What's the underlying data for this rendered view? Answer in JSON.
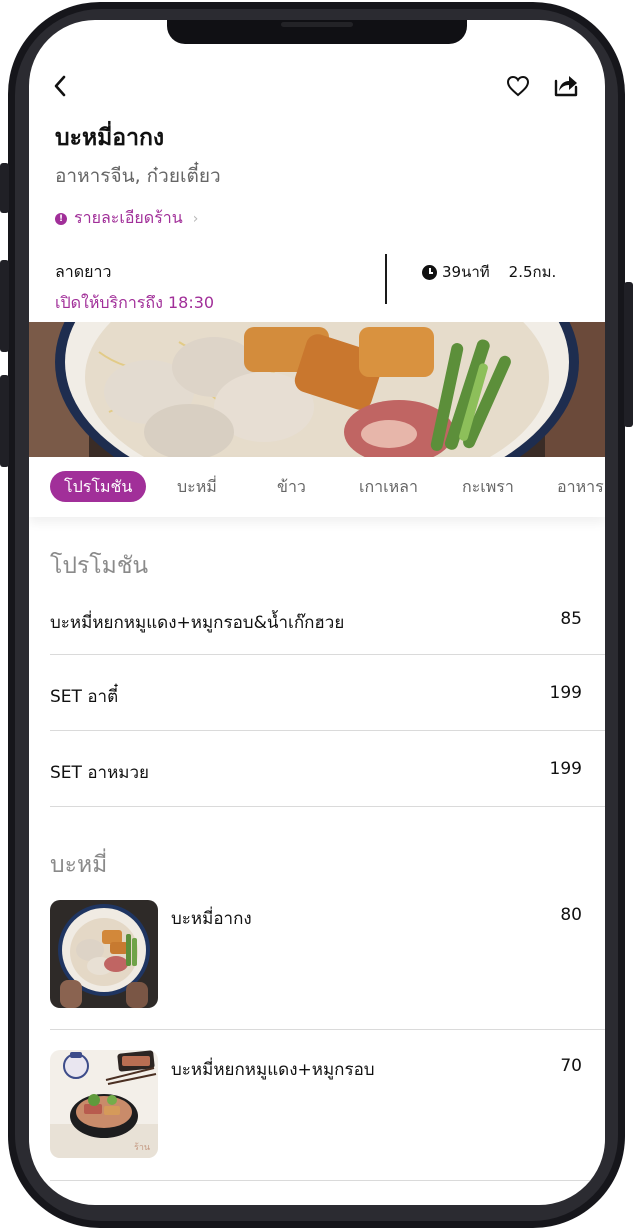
{
  "header": {
    "back_icon": "chevron-left-icon",
    "favorite_icon": "heart-icon",
    "share_icon": "share-icon"
  },
  "shop": {
    "name": "บะหมี่อากง",
    "categories": "อาหารจีน, ก๋วยเตี๋ยว",
    "details_link": "รายละเอียดร้าน",
    "location": "ลาดยาว",
    "hours": "เปิดให้บริการถึง 18:30",
    "eta": "39นาที",
    "distance": "2.5กม."
  },
  "tabs": [
    {
      "label": "โปรโมชัน",
      "active": true
    },
    {
      "label": "บะหมี่",
      "active": false
    },
    {
      "label": "ข้าว",
      "active": false
    },
    {
      "label": "เกาเหลา",
      "active": false
    },
    {
      "label": "กะเพรา",
      "active": false
    },
    {
      "label": "อาหาร",
      "active": false
    }
  ],
  "sections": [
    {
      "title": "โปรโมชัน",
      "items": [
        {
          "name": "บะหมี่หยกหมูแดง+หมูกรอบ&น้ำเก๊กฮวย",
          "price": "85"
        },
        {
          "name": "SET อาตี๋",
          "price": "199"
        },
        {
          "name": "SET อาหมวย",
          "price": "199"
        }
      ]
    },
    {
      "title": "บะหมี่",
      "items": [
        {
          "name": "บะหมี่อากง",
          "price": "80"
        },
        {
          "name": "บะหมี่หยกหมูแดง+หมูกรอบ",
          "price": "70"
        }
      ]
    }
  ],
  "colors": {
    "accent": "#a12f99",
    "text": "#111111",
    "muted": "#666666",
    "divider": "#dadada",
    "frame": "#16161b"
  }
}
